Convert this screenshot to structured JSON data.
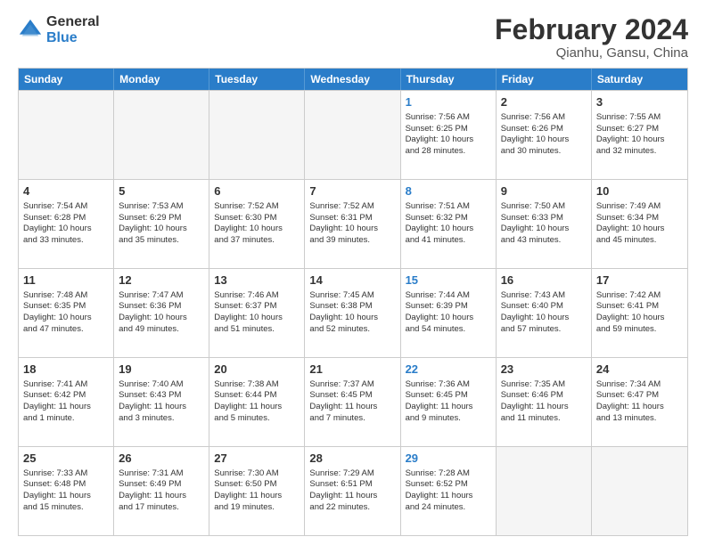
{
  "logo": {
    "general": "General",
    "blue": "Blue"
  },
  "title": "February 2024",
  "subtitle": "Qianhu, Gansu, China",
  "header_days": [
    "Sunday",
    "Monday",
    "Tuesday",
    "Wednesday",
    "Thursday",
    "Friday",
    "Saturday"
  ],
  "rows": [
    [
      {
        "day": "",
        "empty": true,
        "lines": []
      },
      {
        "day": "",
        "empty": true,
        "lines": []
      },
      {
        "day": "",
        "empty": true,
        "lines": []
      },
      {
        "day": "",
        "empty": true,
        "lines": []
      },
      {
        "day": "1",
        "thursday": true,
        "lines": [
          "Sunrise: 7:56 AM",
          "Sunset: 6:25 PM",
          "Daylight: 10 hours",
          "and 28 minutes."
        ]
      },
      {
        "day": "2",
        "lines": [
          "Sunrise: 7:56 AM",
          "Sunset: 6:26 PM",
          "Daylight: 10 hours",
          "and 30 minutes."
        ]
      },
      {
        "day": "3",
        "lines": [
          "Sunrise: 7:55 AM",
          "Sunset: 6:27 PM",
          "Daylight: 10 hours",
          "and 32 minutes."
        ]
      }
    ],
    [
      {
        "day": "4",
        "lines": [
          "Sunrise: 7:54 AM",
          "Sunset: 6:28 PM",
          "Daylight: 10 hours",
          "and 33 minutes."
        ]
      },
      {
        "day": "5",
        "lines": [
          "Sunrise: 7:53 AM",
          "Sunset: 6:29 PM",
          "Daylight: 10 hours",
          "and 35 minutes."
        ]
      },
      {
        "day": "6",
        "lines": [
          "Sunrise: 7:52 AM",
          "Sunset: 6:30 PM",
          "Daylight: 10 hours",
          "and 37 minutes."
        ]
      },
      {
        "day": "7",
        "lines": [
          "Sunrise: 7:52 AM",
          "Sunset: 6:31 PM",
          "Daylight: 10 hours",
          "and 39 minutes."
        ]
      },
      {
        "day": "8",
        "thursday": true,
        "lines": [
          "Sunrise: 7:51 AM",
          "Sunset: 6:32 PM",
          "Daylight: 10 hours",
          "and 41 minutes."
        ]
      },
      {
        "day": "9",
        "lines": [
          "Sunrise: 7:50 AM",
          "Sunset: 6:33 PM",
          "Daylight: 10 hours",
          "and 43 minutes."
        ]
      },
      {
        "day": "10",
        "lines": [
          "Sunrise: 7:49 AM",
          "Sunset: 6:34 PM",
          "Daylight: 10 hours",
          "and 45 minutes."
        ]
      }
    ],
    [
      {
        "day": "11",
        "lines": [
          "Sunrise: 7:48 AM",
          "Sunset: 6:35 PM",
          "Daylight: 10 hours",
          "and 47 minutes."
        ]
      },
      {
        "day": "12",
        "lines": [
          "Sunrise: 7:47 AM",
          "Sunset: 6:36 PM",
          "Daylight: 10 hours",
          "and 49 minutes."
        ]
      },
      {
        "day": "13",
        "lines": [
          "Sunrise: 7:46 AM",
          "Sunset: 6:37 PM",
          "Daylight: 10 hours",
          "and 51 minutes."
        ]
      },
      {
        "day": "14",
        "lines": [
          "Sunrise: 7:45 AM",
          "Sunset: 6:38 PM",
          "Daylight: 10 hours",
          "and 52 minutes."
        ]
      },
      {
        "day": "15",
        "thursday": true,
        "lines": [
          "Sunrise: 7:44 AM",
          "Sunset: 6:39 PM",
          "Daylight: 10 hours",
          "and 54 minutes."
        ]
      },
      {
        "day": "16",
        "lines": [
          "Sunrise: 7:43 AM",
          "Sunset: 6:40 PM",
          "Daylight: 10 hours",
          "and 57 minutes."
        ]
      },
      {
        "day": "17",
        "lines": [
          "Sunrise: 7:42 AM",
          "Sunset: 6:41 PM",
          "Daylight: 10 hours",
          "and 59 minutes."
        ]
      }
    ],
    [
      {
        "day": "18",
        "lines": [
          "Sunrise: 7:41 AM",
          "Sunset: 6:42 PM",
          "Daylight: 11 hours",
          "and 1 minute."
        ]
      },
      {
        "day": "19",
        "lines": [
          "Sunrise: 7:40 AM",
          "Sunset: 6:43 PM",
          "Daylight: 11 hours",
          "and 3 minutes."
        ]
      },
      {
        "day": "20",
        "lines": [
          "Sunrise: 7:38 AM",
          "Sunset: 6:44 PM",
          "Daylight: 11 hours",
          "and 5 minutes."
        ]
      },
      {
        "day": "21",
        "lines": [
          "Sunrise: 7:37 AM",
          "Sunset: 6:45 PM",
          "Daylight: 11 hours",
          "and 7 minutes."
        ]
      },
      {
        "day": "22",
        "thursday": true,
        "lines": [
          "Sunrise: 7:36 AM",
          "Sunset: 6:45 PM",
          "Daylight: 11 hours",
          "and 9 minutes."
        ]
      },
      {
        "day": "23",
        "lines": [
          "Sunrise: 7:35 AM",
          "Sunset: 6:46 PM",
          "Daylight: 11 hours",
          "and 11 minutes."
        ]
      },
      {
        "day": "24",
        "lines": [
          "Sunrise: 7:34 AM",
          "Sunset: 6:47 PM",
          "Daylight: 11 hours",
          "and 13 minutes."
        ]
      }
    ],
    [
      {
        "day": "25",
        "lines": [
          "Sunrise: 7:33 AM",
          "Sunset: 6:48 PM",
          "Daylight: 11 hours",
          "and 15 minutes."
        ]
      },
      {
        "day": "26",
        "lines": [
          "Sunrise: 7:31 AM",
          "Sunset: 6:49 PM",
          "Daylight: 11 hours",
          "and 17 minutes."
        ]
      },
      {
        "day": "27",
        "lines": [
          "Sunrise: 7:30 AM",
          "Sunset: 6:50 PM",
          "Daylight: 11 hours",
          "and 19 minutes."
        ]
      },
      {
        "day": "28",
        "lines": [
          "Sunrise: 7:29 AM",
          "Sunset: 6:51 PM",
          "Daylight: 11 hours",
          "and 22 minutes."
        ]
      },
      {
        "day": "29",
        "thursday": true,
        "lines": [
          "Sunrise: 7:28 AM",
          "Sunset: 6:52 PM",
          "Daylight: 11 hours",
          "and 24 minutes."
        ]
      },
      {
        "day": "",
        "empty": true,
        "lines": []
      },
      {
        "day": "",
        "empty": true,
        "lines": []
      }
    ]
  ]
}
